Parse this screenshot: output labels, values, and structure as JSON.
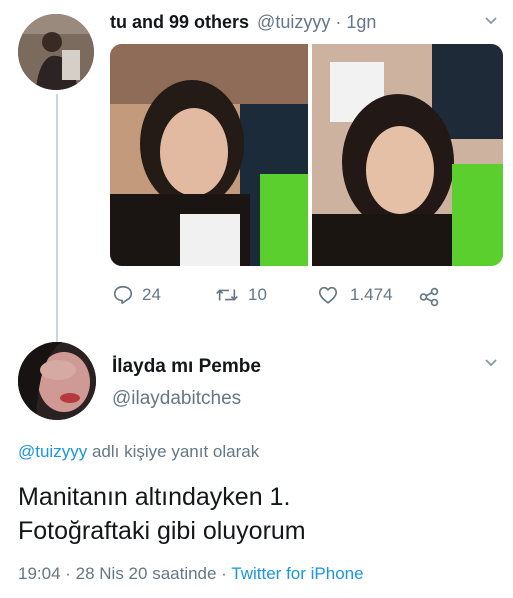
{
  "parent_tweet": {
    "name": "tu and 99 others",
    "handle": "@tuizyyy",
    "separator": "·",
    "time": "1gn",
    "actions": {
      "replies": "24",
      "retweets": "10",
      "likes": "1.474"
    }
  },
  "reply_tweet": {
    "name": "İlayda mı Pembe",
    "handle": "@ilaydabitches",
    "reply_to_handle": "@tuizyyy",
    "reply_to_suffix": "adlı kişiye yanıt olarak",
    "text_line1": "Manitanın altındayken 1.",
    "text_line2": "Fotoğraftaki gibi oluyorum",
    "meta_time_date": "19:04 · 28 Nis 20 saatinde ·",
    "meta_source": "Twitter for iPhone"
  },
  "colors": {
    "link": "#1b95e0",
    "muted": "#657786",
    "text": "#14171a",
    "thread_line": "#ccd6dd"
  },
  "icons": [
    "chevron-down-icon",
    "reply-icon",
    "retweet-icon",
    "like-icon",
    "share-icon"
  ]
}
